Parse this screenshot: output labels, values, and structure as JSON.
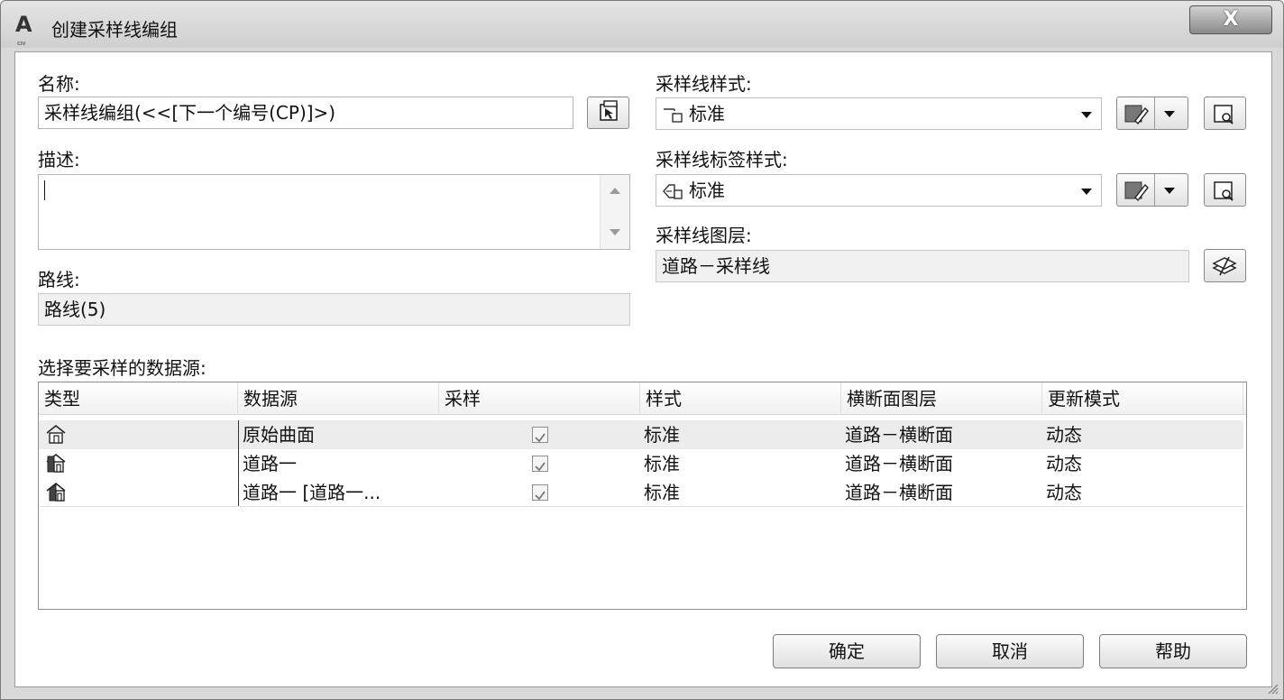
{
  "window": {
    "title": "创建采样线编组",
    "close_label": "X"
  },
  "left": {
    "name_label": "名称:",
    "name_value": "采样线编组(<<[下一个编号(CP)]>)",
    "description_label": "描述:",
    "description_value": "",
    "alignment_label": "路线:",
    "alignment_value": "路线(5)"
  },
  "right": {
    "sample_line_style_label": "采样线样式:",
    "sample_line_style_value": "标准",
    "sample_line_label_style_label": "采样线标签样式:",
    "sample_line_label_style_value": "标准",
    "sample_line_layer_label": "采样线图层:",
    "sample_line_layer_value": "道路－采样线"
  },
  "sources": {
    "label": "选择要采样的数据源:",
    "columns": [
      "类型",
      "数据源",
      "采样",
      "样式",
      "横断面图层",
      "更新模式"
    ],
    "rows": [
      {
        "type_icon": "surface-icon",
        "source": "原始曲面",
        "sampled": true,
        "style": "标准",
        "layer": "道路－横断面",
        "update_mode": "动态"
      },
      {
        "type_icon": "corridor-icon",
        "source": "道路一",
        "sampled": true,
        "style": "标准",
        "layer": "道路－横断面",
        "update_mode": "动态"
      },
      {
        "type_icon": "corridor-surface-icon",
        "source": "道路一 [道路一...",
        "sampled": true,
        "style": "标准",
        "layer": "道路－横断面",
        "update_mode": "动态"
      }
    ]
  },
  "buttons": {
    "ok": "确定",
    "cancel": "取消",
    "help": "帮助"
  }
}
